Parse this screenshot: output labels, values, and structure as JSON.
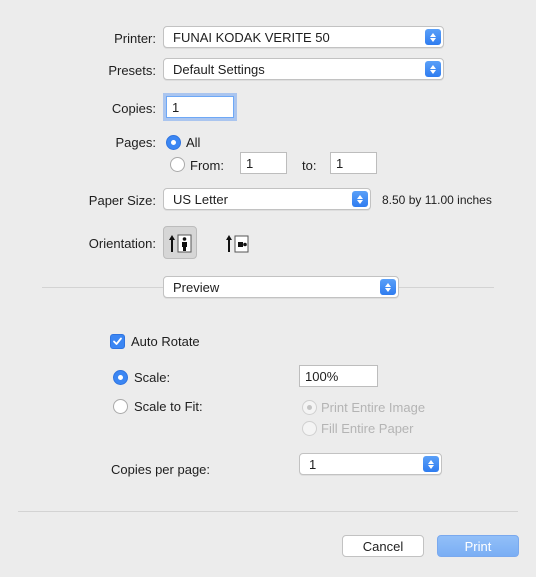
{
  "printer": {
    "label": "Printer:",
    "value": "FUNAI KODAK VERITE 50"
  },
  "presets": {
    "label": "Presets:",
    "value": "Default Settings"
  },
  "copies": {
    "label": "Copies:",
    "value": "1"
  },
  "pages": {
    "label": "Pages:",
    "all_label": "All",
    "from_label": "From:",
    "from_value": "1",
    "to_label": "to:",
    "to_value": "1"
  },
  "paper_size": {
    "label": "Paper Size:",
    "value": "US Letter",
    "dimensions": "8.50 by 11.00 inches"
  },
  "orientation": {
    "label": "Orientation:",
    "selected": "portrait"
  },
  "section": {
    "value": "Preview"
  },
  "auto_rotate": {
    "label": "Auto Rotate",
    "checked": true
  },
  "scale": {
    "label": "Scale:",
    "value": "100%",
    "selected": true
  },
  "scale_to_fit": {
    "label": "Scale to Fit:",
    "print_entire_image": "Print Entire Image",
    "fill_entire_paper": "Fill Entire Paper"
  },
  "copies_per_page": {
    "label": "Copies per page:",
    "value": "1"
  },
  "buttons": {
    "cancel": "Cancel",
    "print": "Print"
  },
  "colors": {
    "accent": "#3b86f3",
    "disabled_text": "#b4b4b4",
    "background": "#ececec"
  }
}
